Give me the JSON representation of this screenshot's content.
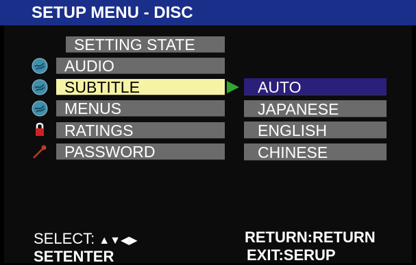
{
  "header": {
    "title": "SETUP MENU - DISC"
  },
  "menu": {
    "items": [
      {
        "label": "SETTING STATE",
        "icon": "none"
      },
      {
        "label": "AUDIO",
        "icon": "globe-icon"
      },
      {
        "label": "SUBTITLE",
        "icon": "globe-icon",
        "selected": true
      },
      {
        "label": "MENUS",
        "icon": "globe-icon"
      },
      {
        "label": "RATINGS",
        "icon": "lock-icon"
      },
      {
        "label": "PASSWORD",
        "icon": "key-icon"
      }
    ]
  },
  "submenu": {
    "items": [
      {
        "label": "AUTO",
        "selected": true
      },
      {
        "label": "JAPANESE"
      },
      {
        "label": "ENGLISH"
      },
      {
        "label": "CHINESE"
      }
    ]
  },
  "footer": {
    "select_label": "SELECT:",
    "arrows": "▲▼◀▶",
    "setenter": "SETENTER",
    "return_label": "RETURN",
    "return_value": "RETURN",
    "exit_label": "EXIT",
    "exit_value": "SERUP"
  },
  "colors": {
    "title_bar": "#1a2f8a",
    "menu_item": "#6b6b6b",
    "selected_item": "#f7f3a6",
    "selected_sub": "#2a1f7a",
    "arrow": "#2fa833"
  }
}
